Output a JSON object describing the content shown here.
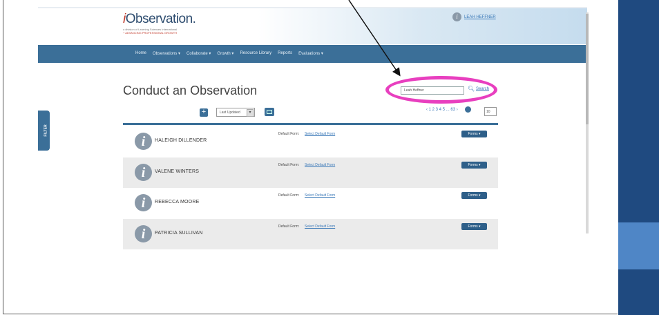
{
  "app": {
    "logo_text_prefix": "i",
    "logo_text": "Observation.",
    "logo_subtitle": "a division of Learning Sciences International",
    "logo_tagline": "+ ADVANCING PROFESSIONAL GROWTH",
    "user_link": "LEAH HEFFNER"
  },
  "nav": {
    "items": [
      "Home",
      "Observations ▾",
      "Collaborate ▾",
      "Growth ▾",
      "Resource Library",
      "Reports",
      "Evaluations ▾"
    ]
  },
  "page": {
    "title": "Conduct an Observation",
    "side_tab_label": "FILTER"
  },
  "search": {
    "value": "Leah Heffner",
    "link_label": "Search"
  },
  "toolbar": {
    "sort_value": "Last Updated",
    "pager_text": "‹ 1 2 3 4 5 ... 63 ›",
    "per_page": "10"
  },
  "rows": [
    {
      "name": "HALEIGH DILLENDER",
      "default_form_label": "Default Form:",
      "default_form_link": "Select Default Form",
      "forms_button": "Forms ▾"
    },
    {
      "name": "VALENE WINTERS",
      "default_form_label": "Default Form:",
      "default_form_link": "Select Default Form",
      "forms_button": "Forms ▾"
    },
    {
      "name": "REBECCA MOORE",
      "default_form_label": "Default Form:",
      "default_form_link": "Select Default Form",
      "forms_button": "Forms ▾"
    },
    {
      "name": "PATRICIA SULLIVAN",
      "default_form_label": "Default Form:",
      "default_form_link": "Select Default Form",
      "forms_button": "Forms ▾"
    }
  ],
  "colors": {
    "nav_bar": "#3b6f98",
    "highlight": "#e83fbf",
    "slide_band": "#1f4a80",
    "slide_band_light": "#4f86c6"
  }
}
